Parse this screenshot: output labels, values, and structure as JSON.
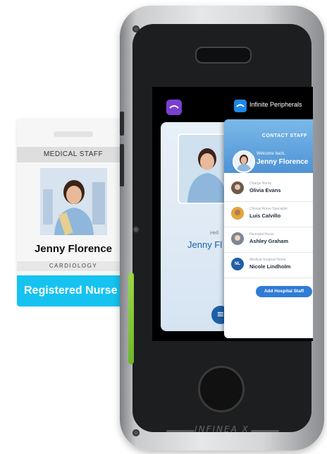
{
  "badge": {
    "header": "MEDICAL STAFF",
    "name": "Jenny Florence",
    "department": "CARDIOLOGY",
    "role": "Registered Nurse",
    "role_color": "#16c3f0"
  },
  "device": {
    "brand": "INFINEA X",
    "accent_color": "#7dc43a"
  },
  "screen": {
    "app_label": "Infinite Peripherals",
    "back_card": {
      "greeting": "Hell",
      "name": "Jenny Fl"
    },
    "contact_card": {
      "title": "CONTACT STAFF",
      "welcome": "Welcome back,",
      "user": "Jenny Florence",
      "staff": [
        {
          "role": "Charge Nurse",
          "name": "Olivia Evans",
          "avatar": "photo"
        },
        {
          "role": "Clinical Nurse Specialist",
          "name": "Luis Calvillo",
          "avatar": "photo"
        },
        {
          "role": "Neonatal Nurse",
          "name": "Ashley Graham",
          "avatar": "photo"
        },
        {
          "role": "Medical-Surgical Nurse",
          "name": "Nicole Lindholm",
          "avatar": "initials",
          "initials": "NL"
        }
      ],
      "add_button": "Add Hospital Staff"
    }
  }
}
